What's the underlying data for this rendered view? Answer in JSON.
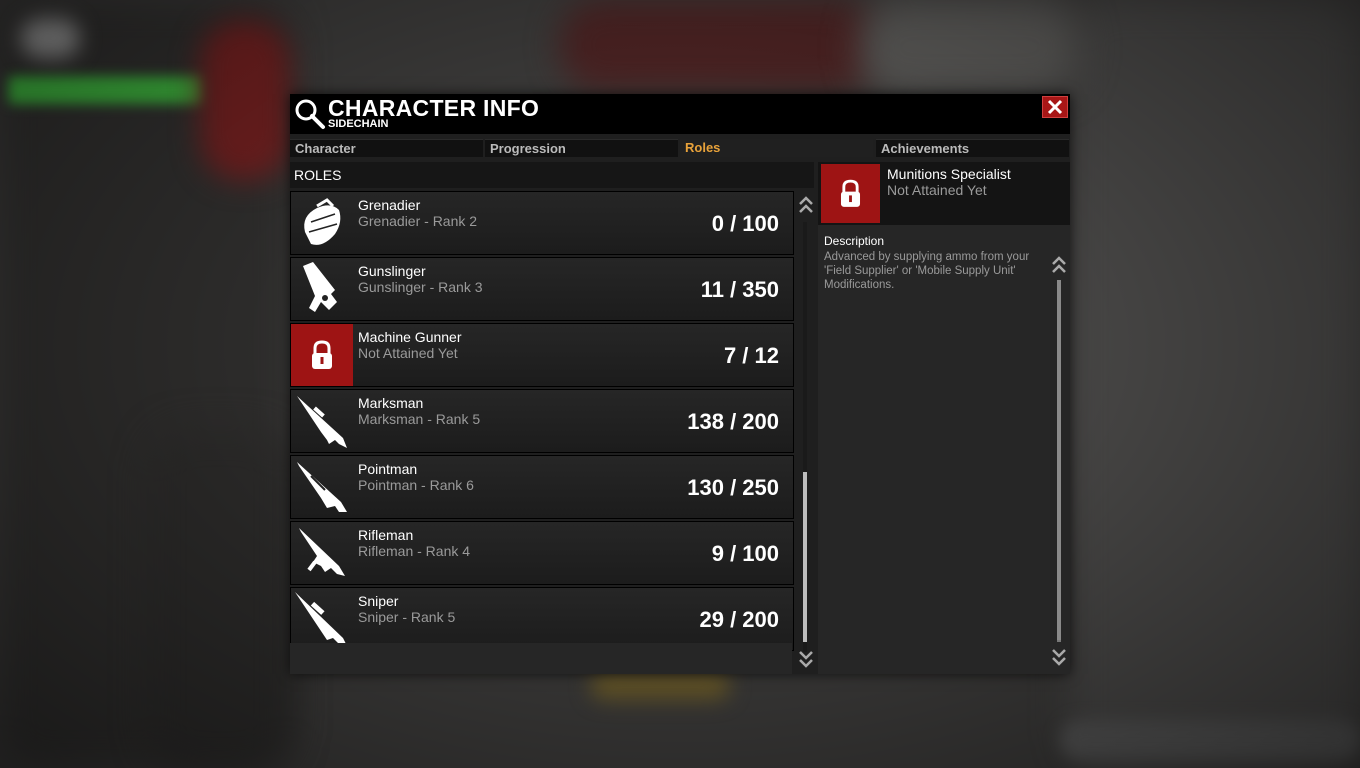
{
  "window": {
    "title": "CHARACTER INFO",
    "subtitle": "SIDECHAIN"
  },
  "tabs": [
    {
      "label": "Character",
      "active": false
    },
    {
      "label": "Progression",
      "active": false
    },
    {
      "label": "Roles",
      "active": true
    },
    {
      "label": "Achievements",
      "active": false
    }
  ],
  "roles_header": "ROLES",
  "roles": [
    {
      "name": "Grenadier",
      "rank": "Grenadier - Rank 2",
      "progress": "0 / 100",
      "icon": "grenade-icon",
      "locked": false
    },
    {
      "name": "Gunslinger",
      "rank": "Gunslinger - Rank 3",
      "progress": "11 / 350",
      "icon": "pistol-icon",
      "locked": false
    },
    {
      "name": "Machine Gunner",
      "rank": "Not Attained Yet",
      "progress": "7 / 12",
      "icon": "lock-icon",
      "locked": true
    },
    {
      "name": "Marksman",
      "rank": "Marksman - Rank 5",
      "progress": "138 / 200",
      "icon": "marksman-rifle-icon",
      "locked": false
    },
    {
      "name": "Pointman",
      "rank": "Pointman - Rank 6",
      "progress": "130 / 250",
      "icon": "shotgun-icon",
      "locked": false
    },
    {
      "name": "Rifleman",
      "rank": "Rifleman - Rank 4",
      "progress": "9 / 100",
      "icon": "assault-rifle-icon",
      "locked": false
    },
    {
      "name": "Sniper",
      "rank": "Sniper - Rank 5",
      "progress": "29 / 200",
      "icon": "sniper-rifle-icon",
      "locked": false
    }
  ],
  "detail": {
    "name": "Munitions Specialist",
    "status": "Not Attained Yet",
    "description_label": "Description",
    "description": "Advanced by supplying ammo from your 'Field Supplier' or 'Mobile Supply Unit' Modifications."
  },
  "colors": {
    "accent": "#e8a23a",
    "locked": "#9e1414",
    "close": "#a81616"
  }
}
